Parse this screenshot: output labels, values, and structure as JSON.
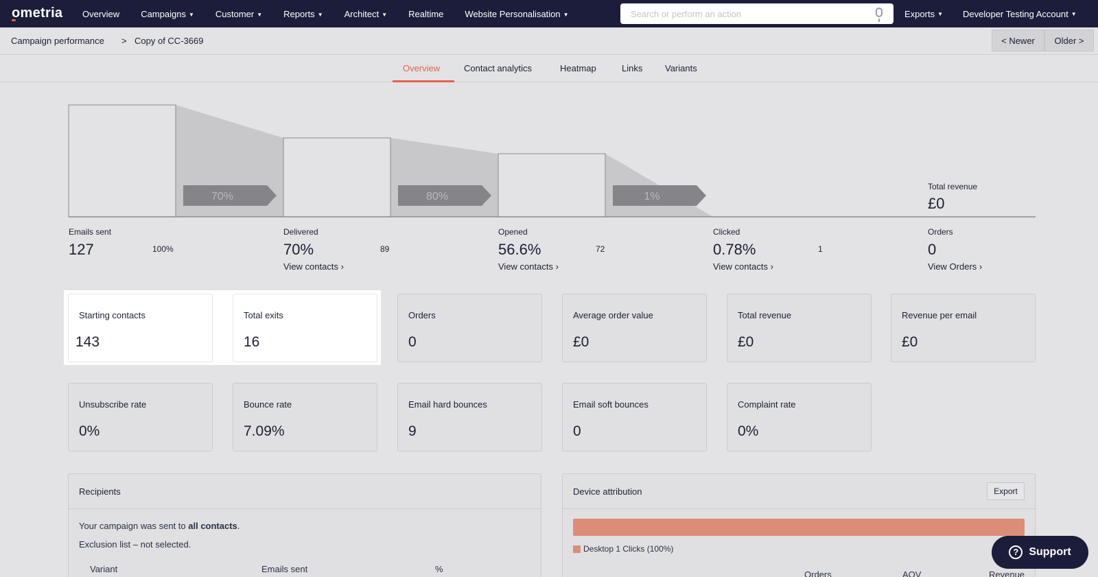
{
  "nav": {
    "logo": "ometria",
    "items": [
      "Overview",
      "Campaigns",
      "Customer",
      "Reports",
      "Architect",
      "Realtime",
      "Website Personalisation"
    ],
    "search_placeholder": "Search or perform an action",
    "exports": "Exports",
    "account": "Developer Testing Account"
  },
  "breadcrumb": {
    "parent": "Campaign performance",
    "separator": ">",
    "current": "Copy of CC-3669",
    "newer": "< Newer",
    "older": "Older >"
  },
  "tabs": [
    "Overview",
    "Contact analytics",
    "Heatmap",
    "Links",
    "Variants"
  ],
  "active_tab": "Overview",
  "funnel": {
    "stages": [
      {
        "label": "Emails sent",
        "value": "127",
        "side": "100%",
        "link": ""
      },
      {
        "label": "Delivered",
        "value": "70%",
        "side": "89",
        "link": "View contacts"
      },
      {
        "label": "Opened",
        "value": "56.6%",
        "side": "72",
        "link": "View contacts"
      },
      {
        "label": "Clicked",
        "value": "0.78%",
        "side": "1",
        "link": "View contacts"
      },
      {
        "label": "Orders",
        "value": "0",
        "side": "",
        "link": "View Orders"
      }
    ],
    "conversions": [
      "70%",
      "80%",
      "1%"
    ],
    "total_revenue_label": "Total revenue",
    "total_revenue_value": "£0",
    "link_chevron": "›"
  },
  "cards_row1": [
    {
      "label": "Starting contacts",
      "value": "143"
    },
    {
      "label": "Total exits",
      "value": "16"
    },
    {
      "label": "Orders",
      "value": "0"
    },
    {
      "label": "Average order value",
      "value": "£0"
    },
    {
      "label": "Total revenue",
      "value": "£0"
    },
    {
      "label": "Revenue per email",
      "value": "£0"
    }
  ],
  "cards_row2": [
    {
      "label": "Unsubscribe rate",
      "value": "0%"
    },
    {
      "label": "Bounce rate",
      "value": "7.09%"
    },
    {
      "label": "Email hard bounces",
      "value": "9"
    },
    {
      "label": "Email soft bounces",
      "value": "0"
    },
    {
      "label": "Complaint rate",
      "value": "0%"
    }
  ],
  "recipients": {
    "title": "Recipients",
    "sent_prefix": "Your campaign was sent to",
    "sent_target": "all contacts",
    "sent_suffix": ".",
    "exclusion": "Exclusion list – not selected.",
    "columns": [
      "Variant",
      "Emails sent",
      "%"
    ]
  },
  "device": {
    "title": "Device attribution",
    "export_label": "Export",
    "legend": "Desktop 1 Clicks (100%)",
    "desktop_share": 1.0,
    "columns": [
      "Orders",
      "AOV",
      "Revenue"
    ]
  },
  "support_label": "Support",
  "colors": {
    "nav_bg": "#1b1d3a",
    "accent": "#e8604c",
    "device_bar": "#db8e77"
  }
}
